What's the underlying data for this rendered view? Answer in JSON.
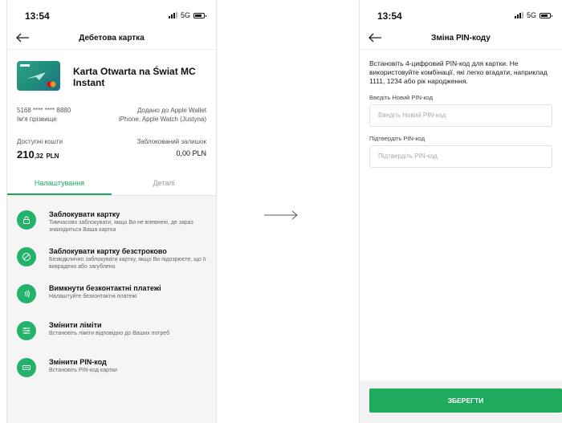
{
  "left": {
    "status": {
      "time": "13:54",
      "network": "5G"
    },
    "nav": {
      "title": "Дебетова картка"
    },
    "card": {
      "name": "Karta Otwarta na Świat MC Instant"
    },
    "info": {
      "card_number": "5168 **** **** 8880",
      "holder": "Ім'я прізвище",
      "wallet_line1": "Додано до Apple Wallet",
      "wallet_line2": "iPhone, Apple Watch (Justyna)"
    },
    "balance": {
      "available_label": "Доступні кошти",
      "available_int": "210",
      "available_dec": ",32",
      "available_currency": "PLN",
      "blocked_label": "Заблокований залишок",
      "blocked_value": "0,00 PLN"
    },
    "tabs": [
      {
        "label": "Налаштування",
        "active": true
      },
      {
        "label": "Деталі",
        "active": false
      }
    ],
    "actions": [
      {
        "title": "Заблокувати картку",
        "desc": "Тимчасово заблокувати, якщо Ви не впевнені, де зараз знаходиться Ваша картка",
        "icon": "lock-icon"
      },
      {
        "title": "Заблокувати картку безстроково",
        "desc": "Безвідклично заблокувати картку, якщо Ви підозрюєте, що її викрадено або загублено",
        "icon": "block-icon"
      },
      {
        "title": "Вимкнути безконтактні платежі",
        "desc": "Налаштуйте безконтактні платежі",
        "icon": "contactless-icon"
      },
      {
        "title": "Змінити ліміти",
        "desc": "Встановіть ліміти відповідно до Ваших потреб",
        "icon": "sliders-icon"
      },
      {
        "title": "Змінити PIN-код",
        "desc": "Встановіть PIN-код картки",
        "icon": "pin-icon"
      }
    ]
  },
  "right": {
    "status": {
      "time": "13:54",
      "network": "5G"
    },
    "nav": {
      "title": "Зміна PIN-коду"
    },
    "description": "Встановіть 4-цифровий PIN-код для картки. Не використовуйте комбінації, які легко вгадати, наприклад 1111, 1234 або рік народження.",
    "new_pin": {
      "label": "Введіть Новий PIN-код",
      "placeholder": "Введіть Новий PIN-код"
    },
    "confirm_pin": {
      "label": "Підтвердіть PIN-код",
      "placeholder": "Підтвердіть PIN-код"
    },
    "save_label": "ЗБЕРЕГТИ"
  },
  "colors": {
    "accent": "#23b26a",
    "tab_active": "#1aaa5c",
    "button": "#1faa5d"
  }
}
